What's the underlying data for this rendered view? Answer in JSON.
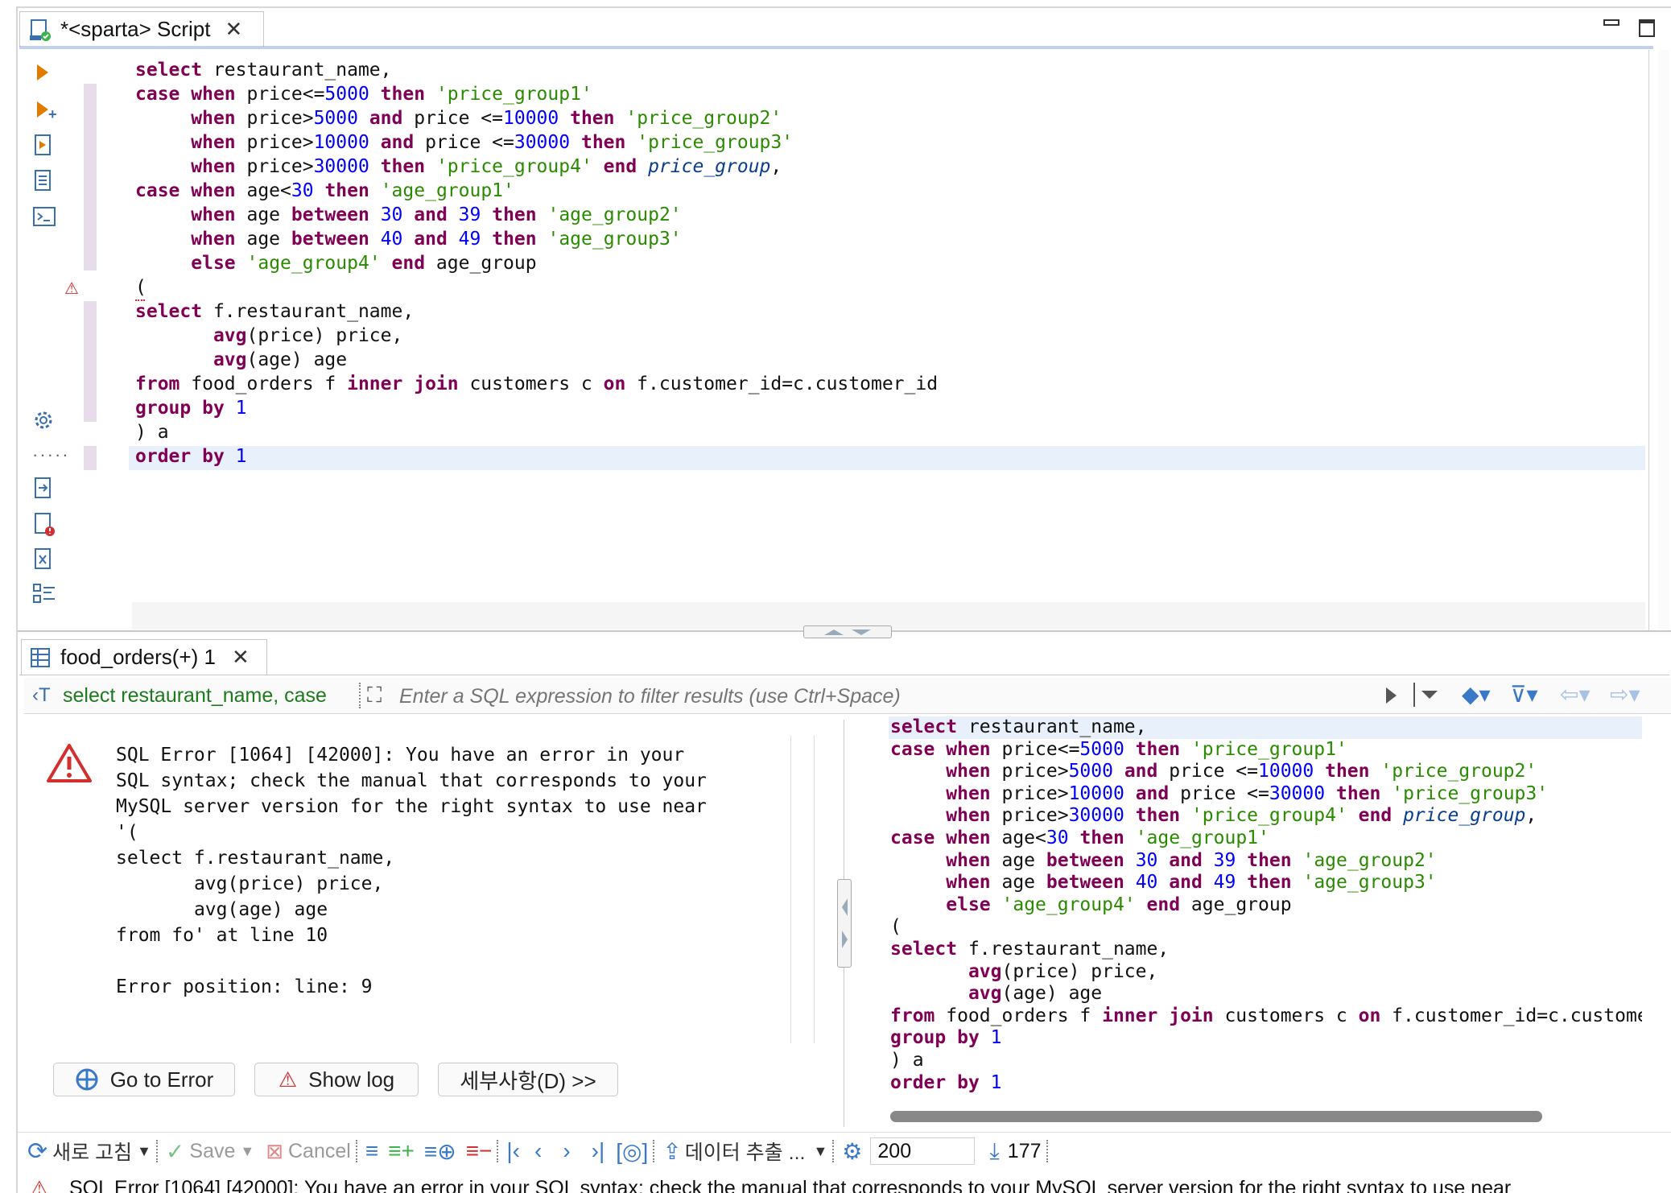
{
  "editor_tab": {
    "title": "*<sparta> Script"
  },
  "editor_lines": [
    [
      [
        "kw",
        "select"
      ],
      [
        "t",
        " restaurant_name,"
      ]
    ],
    [
      [
        "kw",
        "case"
      ],
      [
        "t",
        " "
      ],
      [
        "kw",
        "when"
      ],
      [
        "t",
        " price<="
      ],
      [
        "num",
        "5000"
      ],
      [
        "t",
        " "
      ],
      [
        "kw",
        "then"
      ],
      [
        "t",
        " "
      ],
      [
        "str",
        "'price_group1'"
      ]
    ],
    [
      [
        "t",
        "     "
      ],
      [
        "kw",
        "when"
      ],
      [
        "t",
        " price>"
      ],
      [
        "num",
        "5000"
      ],
      [
        "t",
        " "
      ],
      [
        "kw",
        "and"
      ],
      [
        "t",
        " price <="
      ],
      [
        "num",
        "10000"
      ],
      [
        "t",
        " "
      ],
      [
        "kw",
        "then"
      ],
      [
        "t",
        " "
      ],
      [
        "str",
        "'price_group2'"
      ]
    ],
    [
      [
        "t",
        "     "
      ],
      [
        "kw",
        "when"
      ],
      [
        "t",
        " price>"
      ],
      [
        "num",
        "10000"
      ],
      [
        "t",
        " "
      ],
      [
        "kw",
        "and"
      ],
      [
        "t",
        " price <="
      ],
      [
        "num",
        "30000"
      ],
      [
        "t",
        " "
      ],
      [
        "kw",
        "then"
      ],
      [
        "t",
        " "
      ],
      [
        "str",
        "'price_group3'"
      ]
    ],
    [
      [
        "t",
        "     "
      ],
      [
        "kw",
        "when"
      ],
      [
        "t",
        " price>"
      ],
      [
        "num",
        "30000"
      ],
      [
        "t",
        " "
      ],
      [
        "kw",
        "then"
      ],
      [
        "t",
        " "
      ],
      [
        "str",
        "'price_group4'"
      ],
      [
        "t",
        " "
      ],
      [
        "kw",
        "end"
      ],
      [
        "t",
        " "
      ],
      [
        "ali",
        "price_group"
      ],
      [
        "t",
        ","
      ]
    ],
    [
      [
        "kw",
        "case"
      ],
      [
        "t",
        " "
      ],
      [
        "kw",
        "when"
      ],
      [
        "t",
        " age<"
      ],
      [
        "num",
        "30"
      ],
      [
        "t",
        " "
      ],
      [
        "kw",
        "then"
      ],
      [
        "t",
        " "
      ],
      [
        "str",
        "'age_group1'"
      ]
    ],
    [
      [
        "t",
        "     "
      ],
      [
        "kw",
        "when"
      ],
      [
        "t",
        " age "
      ],
      [
        "kw",
        "between"
      ],
      [
        "t",
        " "
      ],
      [
        "num",
        "30"
      ],
      [
        "t",
        " "
      ],
      [
        "kw",
        "and"
      ],
      [
        "t",
        " "
      ],
      [
        "num",
        "39"
      ],
      [
        "t",
        " "
      ],
      [
        "kw",
        "then"
      ],
      [
        "t",
        " "
      ],
      [
        "str",
        "'age_group2'"
      ]
    ],
    [
      [
        "t",
        "     "
      ],
      [
        "kw",
        "when"
      ],
      [
        "t",
        " age "
      ],
      [
        "kw",
        "between"
      ],
      [
        "t",
        " "
      ],
      [
        "num",
        "40"
      ],
      [
        "t",
        " "
      ],
      [
        "kw",
        "and"
      ],
      [
        "t",
        " "
      ],
      [
        "num",
        "49"
      ],
      [
        "t",
        " "
      ],
      [
        "kw",
        "then"
      ],
      [
        "t",
        " "
      ],
      [
        "str",
        "'age_group3'"
      ]
    ],
    [
      [
        "t",
        "     "
      ],
      [
        "kw",
        "else"
      ],
      [
        "t",
        " "
      ],
      [
        "str",
        "'age_group4'"
      ],
      [
        "t",
        " "
      ],
      [
        "kw",
        "end"
      ],
      [
        "t",
        " age_group"
      ]
    ],
    [
      [
        "t",
        "("
      ]
    ],
    [
      [
        "kw",
        "select"
      ],
      [
        "t",
        " f.restaurant_name,"
      ]
    ],
    [
      [
        "t",
        "       "
      ],
      [
        "kw",
        "avg"
      ],
      [
        "t",
        "(price) price,"
      ]
    ],
    [
      [
        "t",
        "       "
      ],
      [
        "kw",
        "avg"
      ],
      [
        "t",
        "(age) age"
      ]
    ],
    [
      [
        "kw",
        "from"
      ],
      [
        "t",
        " food_orders f "
      ],
      [
        "kw",
        "inner"
      ],
      [
        "t",
        " "
      ],
      [
        "kw",
        "join"
      ],
      [
        "t",
        " customers c "
      ],
      [
        "kw",
        "on"
      ],
      [
        "t",
        " f.customer_id=c.customer_id"
      ]
    ],
    [
      [
        "kw",
        "group"
      ],
      [
        "t",
        " "
      ],
      [
        "kw",
        "by"
      ],
      [
        "t",
        " "
      ],
      [
        "num",
        "1"
      ]
    ],
    [
      [
        "t",
        ") a"
      ]
    ],
    [
      [
        "kw",
        "order"
      ],
      [
        "t",
        " "
      ],
      [
        "kw",
        "by"
      ],
      [
        "t",
        " "
      ],
      [
        "num",
        "1"
      ]
    ]
  ],
  "results_tab": {
    "title": "food_orders(+) 1"
  },
  "filter_bar": {
    "query_label": "select restaurant_name, case",
    "placeholder": "Enter a SQL expression to filter results (use Ctrl+Space)"
  },
  "error_panel": {
    "message": "SQL Error [1064] [42000]: You have an error in your\nSQL syntax; check the manual that corresponds to your\nMySQL server version for the right syntax to use near\n'(\nselect f.restaurant_name,\n       avg(price) price,\n       avg(age) age\nfrom fo' at line 10\n\nError position: line: 9",
    "go_to_error": "Go to Error",
    "show_log": "Show log",
    "details": "세부사항(D) >>"
  },
  "bottom_toolbar": {
    "refresh": "새로 고침",
    "save": "Save",
    "cancel": "Cancel",
    "export": "데이터 추출 ...",
    "fetch_size": "200",
    "row_count": "177"
  },
  "status_bar": {
    "message": "SQL Error [1064] [42000]: You have an error in your SQL syntax; check the manual that corresponds to your MySQL server version for the right syntax to use near"
  },
  "colors": {
    "keyword": "#7f0055",
    "number": "#0000ff",
    "string": "#2a8a00",
    "alias": "#0a3d8c",
    "error": "#d32f2f",
    "accent": "#3a79c8"
  }
}
